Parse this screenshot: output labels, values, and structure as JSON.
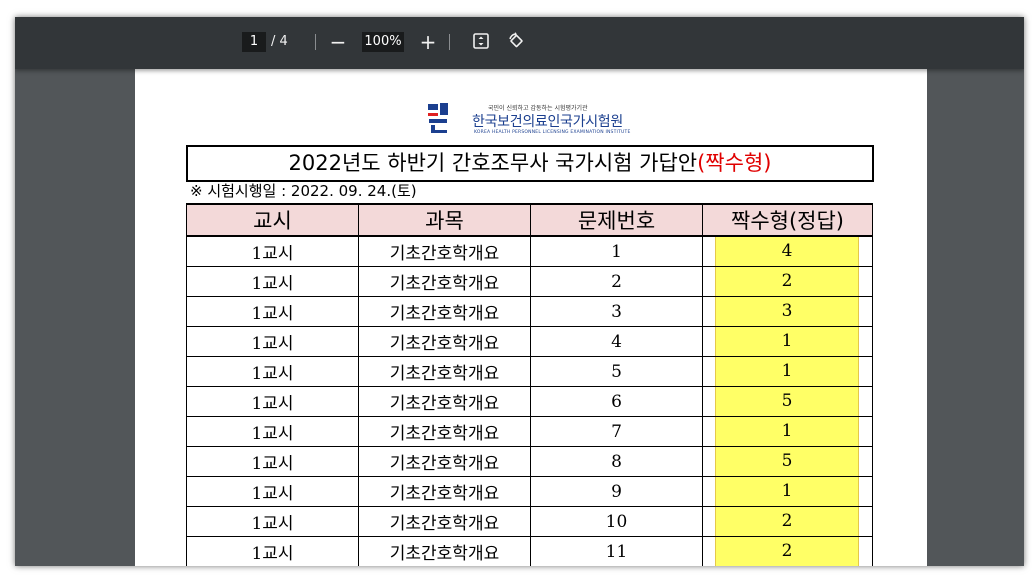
{
  "toolbar": {
    "page_current": "1",
    "page_total": "/ 4",
    "zoom_out_label": "−",
    "zoom_value": "100%",
    "zoom_in_label": "+",
    "fit_icon": "fit-page-icon",
    "rotate_icon": "rotate-icon"
  },
  "document": {
    "logo": {
      "mark_text": "국시원",
      "slogan": "국민이 신뢰하고 감동하는 시험평가기관",
      "name": "한국보건의료인국가시험원",
      "english": "KOREA HEALTH PERSONNEL LICENSING EXAMINATION INSTITUTE"
    },
    "title_main": "2022년도 하반기 간호조무사 국가시험 가답안",
    "title_highlight": "(짝수형)",
    "exam_date": "※ 시험시행일 : 2022. 09. 24.(토)",
    "table": {
      "headers": [
        "교시",
        "과목",
        "문제번호",
        "짝수형(정답)"
      ],
      "rows": [
        [
          "1교시",
          "기초간호학개요",
          "1",
          "4"
        ],
        [
          "1교시",
          "기초간호학개요",
          "2",
          "2"
        ],
        [
          "1교시",
          "기초간호학개요",
          "3",
          "3"
        ],
        [
          "1교시",
          "기초간호학개요",
          "4",
          "1"
        ],
        [
          "1교시",
          "기초간호학개요",
          "5",
          "1"
        ],
        [
          "1교시",
          "기초간호학개요",
          "6",
          "5"
        ],
        [
          "1교시",
          "기초간호학개요",
          "7",
          "1"
        ],
        [
          "1교시",
          "기초간호학개요",
          "8",
          "5"
        ],
        [
          "1교시",
          "기초간호학개요",
          "9",
          "1"
        ],
        [
          "1교시",
          "기초간호학개요",
          "10",
          "2"
        ],
        [
          "1교시",
          "기초간호학개요",
          "11",
          "2"
        ]
      ]
    }
  },
  "colors": {
    "toolbar_bg": "#323639",
    "viewer_bg": "#525659",
    "header_fill": "#f3d9d9",
    "answer_highlight": "#ffff66",
    "title_accent": "#e00000",
    "logo_blue": "#1b3f8f"
  }
}
